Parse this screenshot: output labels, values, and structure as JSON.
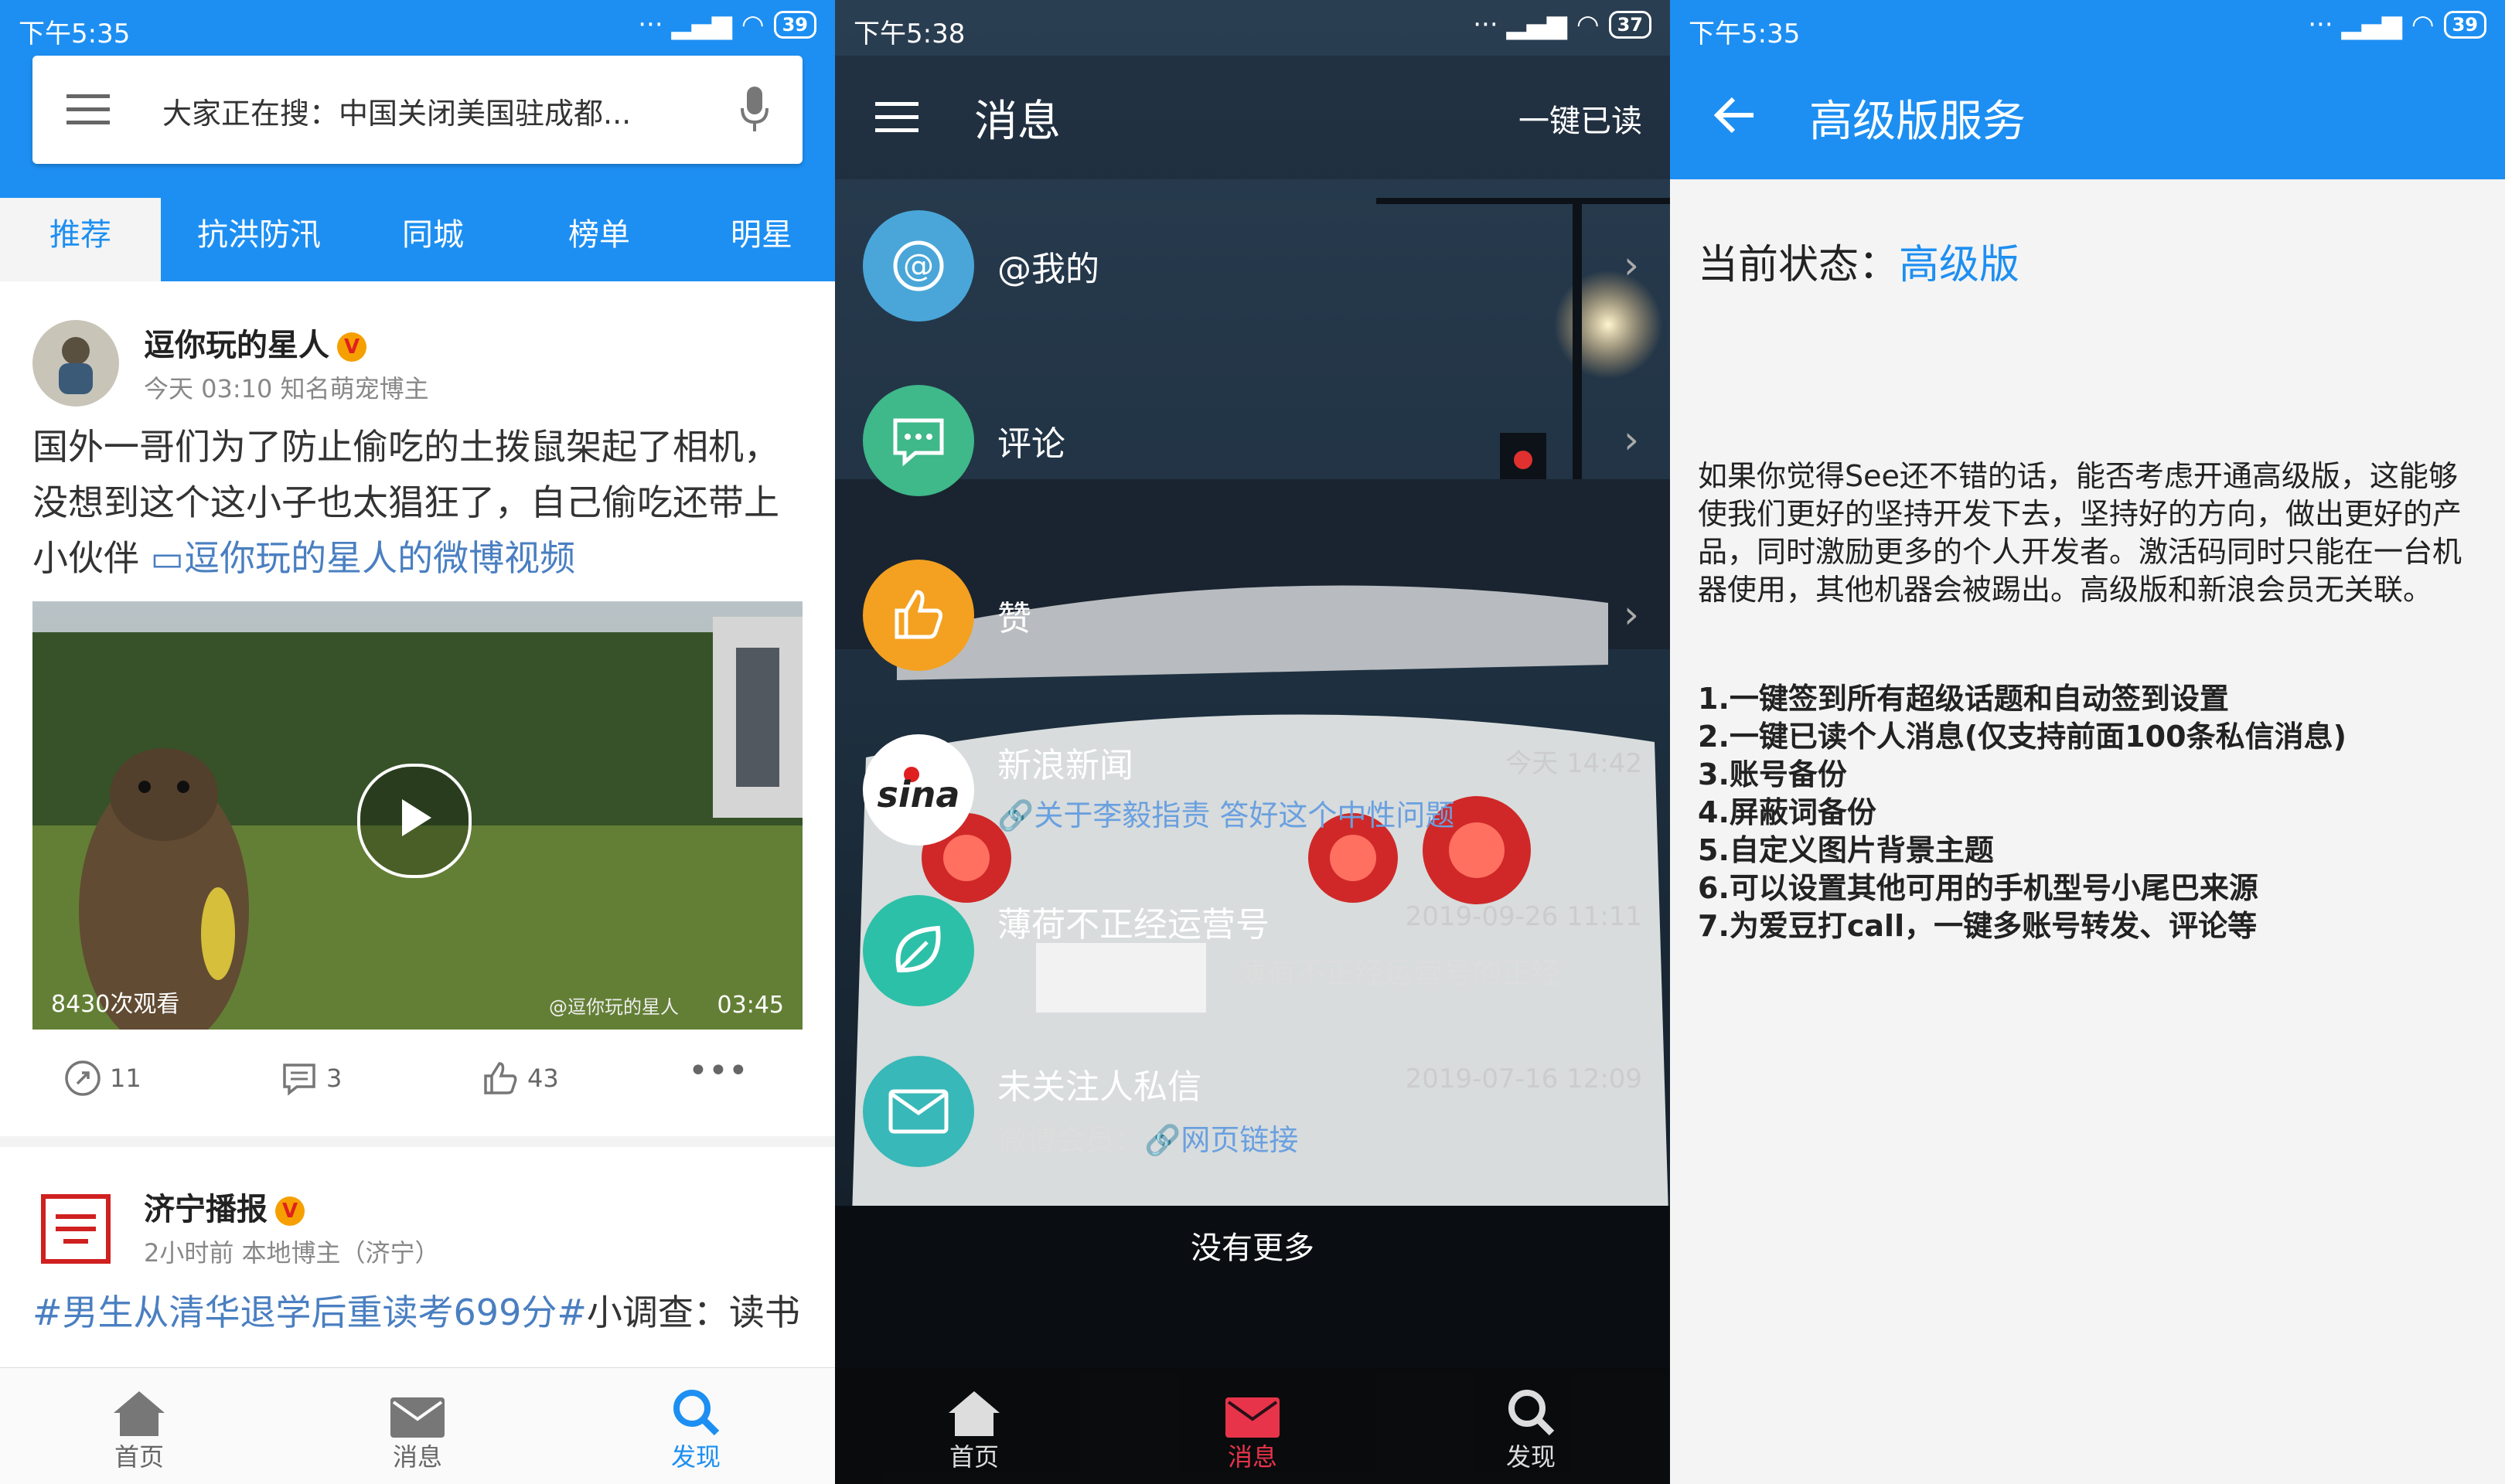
{
  "panel1": {
    "status": {
      "time": "下午5:35",
      "battery": "39"
    },
    "search": {
      "text": "大家正在搜：中国关闭美国驻成都..."
    },
    "tabs": [
      "推荐",
      "抗洪防汛",
      "同城",
      "榜单",
      "明星"
    ],
    "post1": {
      "user": "逗你玩的星人",
      "meta": "今天 03:10  知名萌宠博主",
      "text": "国外一哥们为了防止偷吃的土拨鼠架起了相机，没想到这个这小子也太猖狂了，自己偷吃还带上小伙伴",
      "link": "逗你玩的星人的微博视频",
      "views": "8430次观看",
      "watermark": "@逗你玩的星人",
      "duration": "03:45",
      "reposts": "11",
      "comments": "3",
      "likes": "43"
    },
    "post2": {
      "user": "济宁播报",
      "meta": "2小时前  本地博主（济宁）",
      "text_tag": "#男生从清华退学后重读考699分#",
      "text_rest": "小调查：读书"
    },
    "nav": [
      "首页",
      "消息",
      "发现"
    ],
    "accent": "#1d8ff2"
  },
  "panel2": {
    "status": {
      "time": "下午5:38",
      "battery": "37"
    },
    "title": "消息",
    "read_all": "一键已读",
    "rows": [
      {
        "label": "@我的"
      },
      {
        "label": "评论"
      },
      {
        "label": "赞"
      },
      {
        "label": "新浪新闻",
        "time": "今天 14:42",
        "sub": "关于李毅指责 答好这个中性问题"
      },
      {
        "label": "薄荷不正经运营号",
        "time": "2019-09-26 11:11",
        "sub": "薄荷不正经运营号的正经"
      },
      {
        "label": "未关注人私信",
        "time": "2019-07-16 12:09",
        "sub_prefix": "微博会员：",
        "sub_link": "网页链接"
      }
    ],
    "no_more": "没有更多",
    "nav": [
      "首页",
      "消息",
      "发现"
    ],
    "nav_active_color": "#e8344a"
  },
  "panel3": {
    "status": {
      "time": "下午5:35",
      "battery": "39"
    },
    "title": "高级版服务",
    "state_label": "当前状态：",
    "state_value": "高级版",
    "description": "如果你觉得See还不错的话，能否考虑开通高级版，这能够使我们更好的坚持开发下去，坚持好的方向，做出更好的产品，同时激励更多的个人开发者。激活码同时只能在一台机器使用，其他机器会被踢出。高级版和新浪会员无关联。",
    "features": [
      "1.一键签到所有超级话题和自动签到设置",
      "2.一键已读个人消息(仅支持前面100条私信消息)",
      "3.账号备份",
      "4.屏蔽词备份",
      "5.自定义图片背景主题",
      "6.可以设置其他可用的手机型号小尾巴来源",
      "7.为爱豆打call，一键多账号转发、评论等"
    ]
  }
}
